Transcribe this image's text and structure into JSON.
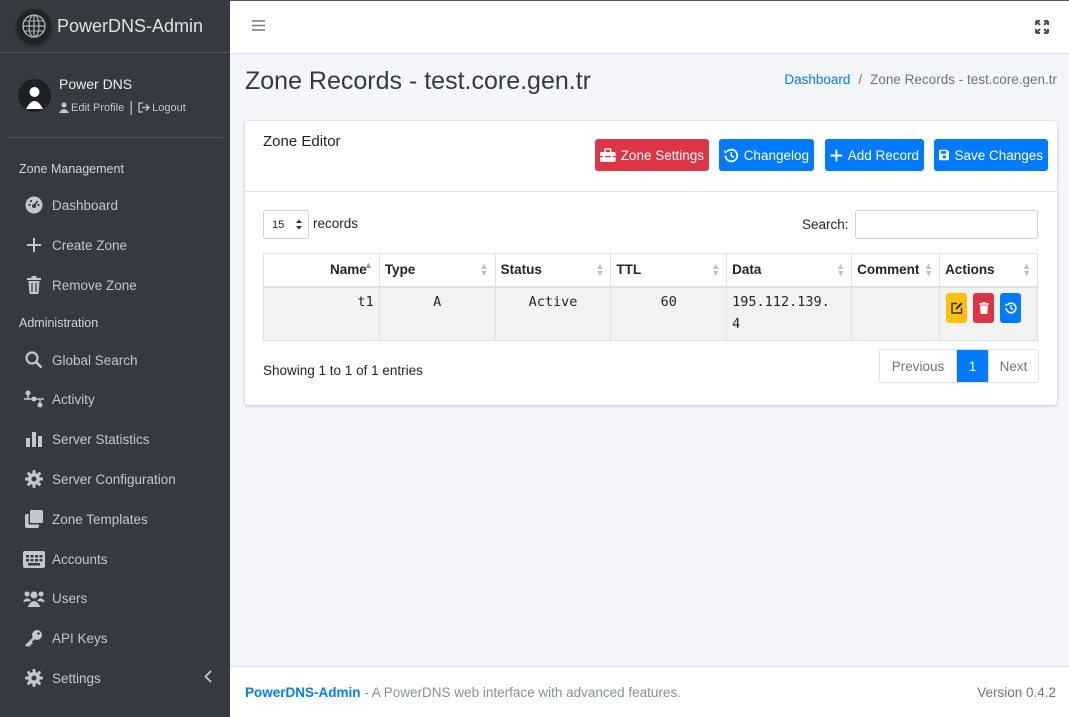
{
  "colors": {
    "sidebar_bg": "#343a40",
    "primary": "#007bff",
    "danger": "#dc3545",
    "warning": "#ffc107"
  },
  "brand": {
    "name": "PowerDNS-Admin",
    "icon": "globe-icon"
  },
  "user": {
    "name": "Power DNS",
    "edit_profile": "Edit Profile",
    "logout": "Logout"
  },
  "sidebar": {
    "zone_management_header": "Zone Management",
    "administration_header": "Administration",
    "items": [
      {
        "label": "Dashboard",
        "icon": "dashboard-icon"
      },
      {
        "label": "Create Zone",
        "icon": "plus-icon"
      },
      {
        "label": "Remove Zone",
        "icon": "trash-icon"
      },
      {
        "label": "Global Search",
        "icon": "search-icon"
      },
      {
        "label": "Activity",
        "icon": "activity-icon"
      },
      {
        "label": "Server Statistics",
        "icon": "chart-icon"
      },
      {
        "label": "Server Configuration",
        "icon": "gear-icon"
      },
      {
        "label": "Zone Templates",
        "icon": "clone-icon"
      },
      {
        "label": "Accounts",
        "icon": "accounts-icon"
      },
      {
        "label": "Users",
        "icon": "users-icon"
      },
      {
        "label": "API Keys",
        "icon": "key-icon"
      },
      {
        "label": "Settings",
        "icon": "gear-icon"
      }
    ]
  },
  "page": {
    "title": "Zone Records - test.core.gen.tr"
  },
  "breadcrumb": {
    "home": "Dashboard",
    "separator": "/",
    "current": "Zone Records - test.core.gen.tr"
  },
  "card": {
    "title": "Zone Editor",
    "buttons": {
      "zone_settings": "Zone Settings",
      "changelog": "Changelog",
      "add_record": "Add Record",
      "save_changes": "Save Changes"
    }
  },
  "table_controls": {
    "page_length": "15",
    "records_label": "records",
    "search_label": "Search:",
    "search_value": ""
  },
  "table": {
    "columns": [
      "Name",
      "Type",
      "Status",
      "TTL",
      "Data",
      "Comment",
      "Actions"
    ],
    "rows": [
      {
        "name": "t1",
        "type": "A",
        "status": "Active",
        "ttl": "60",
        "data_line1": "195.112.139.",
        "data_line2": "4",
        "comment": ""
      }
    ]
  },
  "pagination": {
    "info": "Showing 1 to 1 of 1 entries",
    "previous": "Previous",
    "current": "1",
    "next": "Next"
  },
  "footer": {
    "brand": "PowerDNS-Admin",
    "tagline": "- A PowerDNS web interface with advanced features.",
    "version": "Version 0.4.2"
  }
}
